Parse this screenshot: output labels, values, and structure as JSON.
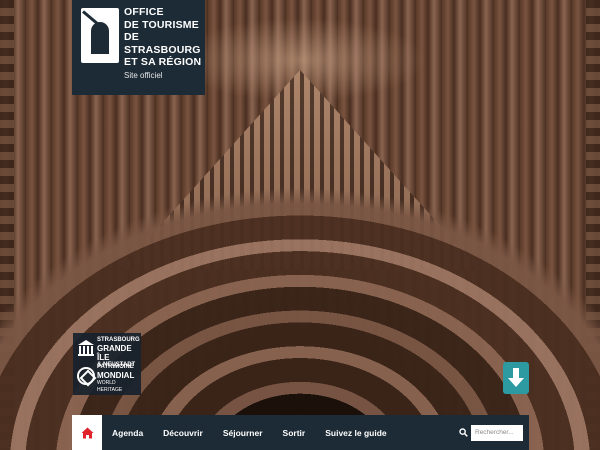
{
  "logo": {
    "title_lines": [
      "OFFICE",
      "DE TOURISME",
      "DE STRASBOURG",
      "ET SA RÉGION"
    ],
    "subtitle": "Site officiel"
  },
  "unesco_badge": {
    "line1": "STRASBOURG",
    "line2": "GRANDE ÎLE",
    "line3": "& NEUSTADT",
    "line4": "PATRIMOINE",
    "line5": "MONDIAL",
    "line6": "WORLD HERITAGE"
  },
  "nav": {
    "items": [
      {
        "label": "Agenda"
      },
      {
        "label": "Découvrir"
      },
      {
        "label": "Séjourner"
      },
      {
        "label": "Sortir"
      },
      {
        "label": "Suivez le guide"
      }
    ],
    "search_placeholder": "Rechercher..."
  },
  "colors": {
    "nav_bg": "#1d2b36",
    "home_icon": "#e0232b",
    "scroll_button": "#2c9aa0"
  },
  "icons": {
    "home": "home-icon",
    "search": "search-icon",
    "scroll": "arrow-down-icon"
  }
}
